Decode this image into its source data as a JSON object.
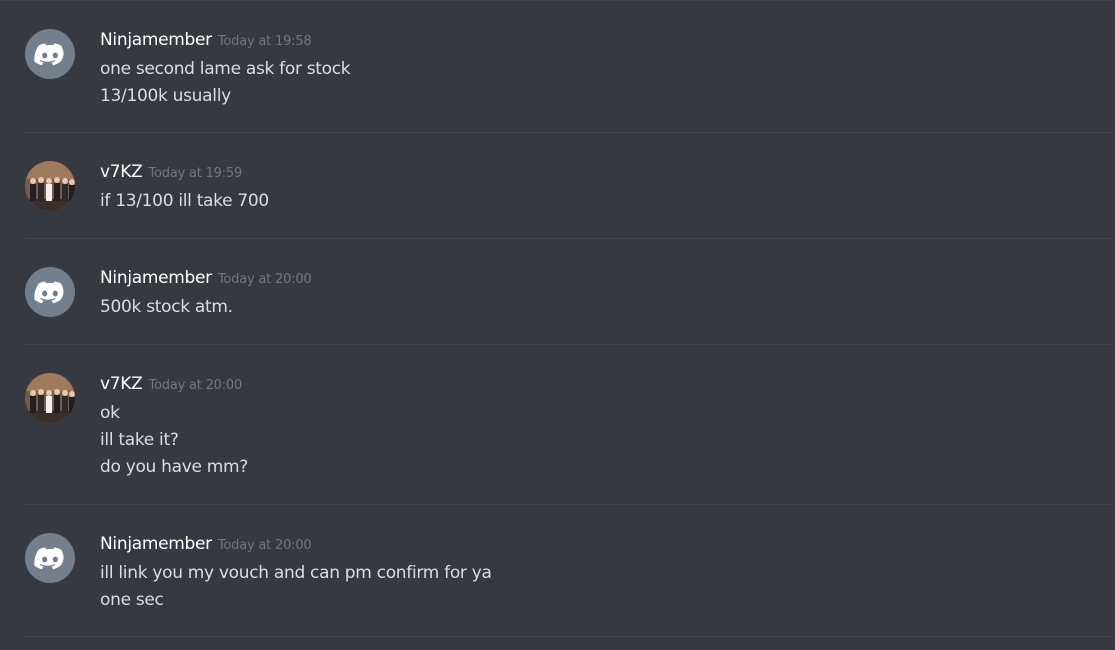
{
  "colors": {
    "background": "#36393f",
    "divider": "#42454a",
    "username": "#ffffff",
    "timestamp": "#72767d",
    "message_text": "#dcddde",
    "default_avatar_bg": "#747f8d"
  },
  "messages": [
    {
      "username": "Ninjamember",
      "timestamp": "Today at 19:58",
      "avatar": "discord-logo-icon",
      "lines": [
        "one second lame ask for stock",
        "13/100k usually"
      ]
    },
    {
      "username": "v7KZ",
      "timestamp": "Today at 19:59",
      "avatar": "group-photo-avatar",
      "lines": [
        "if 13/100 ill take 700"
      ]
    },
    {
      "username": "Ninjamember",
      "timestamp": "Today at 20:00",
      "avatar": "discord-logo-icon",
      "lines": [
        "500k stock atm."
      ]
    },
    {
      "username": "v7KZ",
      "timestamp": "Today at 20:00",
      "avatar": "group-photo-avatar",
      "lines": [
        "ok",
        "ill take it?",
        "do you have mm?"
      ]
    },
    {
      "username": "Ninjamember",
      "timestamp": "Today at 20:00",
      "avatar": "discord-logo-icon",
      "lines": [
        "ill link you my vouch and can pm confirm for ya",
        "one sec"
      ]
    }
  ]
}
